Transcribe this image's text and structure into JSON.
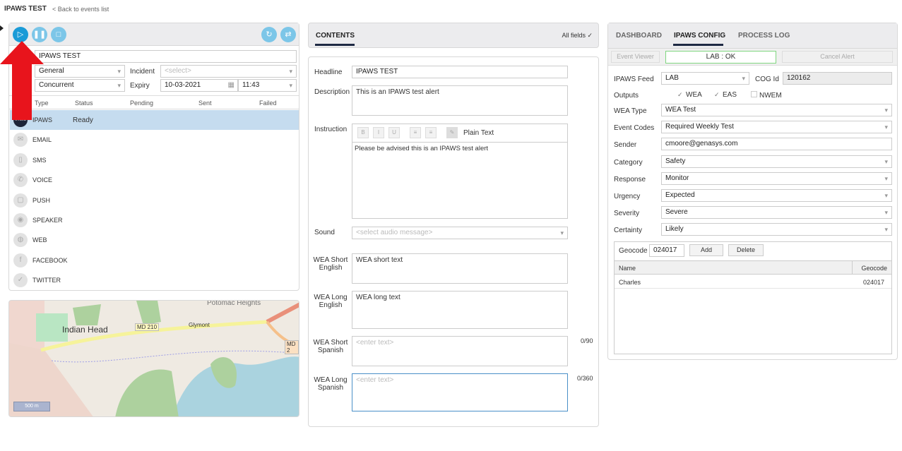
{
  "page": {
    "title": "IPAWS TEST",
    "back_link": "< Back to events list"
  },
  "left": {
    "event_label": "E",
    "event_value": "IPAWS TEST",
    "type_value": "General",
    "incident_label": "Incident",
    "incident_placeholder": "<select>",
    "mode_value": "Concurrent",
    "expiry_label": "Expiry",
    "expiry_date": "10-03-2021",
    "expiry_time": "11:43",
    "columns": [
      "Type",
      "Status",
      "Pending",
      "Sent",
      "Failed"
    ],
    "channels": [
      {
        "name": "IPAWS",
        "status": "Ready",
        "icon": "ipaws-logo-icon"
      },
      {
        "name": "EMAIL",
        "status": "",
        "icon": "email-icon"
      },
      {
        "name": "SMS",
        "status": "",
        "icon": "sms-icon"
      },
      {
        "name": "VOICE",
        "status": "",
        "icon": "phone-icon"
      },
      {
        "name": "PUSH",
        "status": "",
        "icon": "push-icon"
      },
      {
        "name": "SPEAKER",
        "status": "",
        "icon": "speaker-icon"
      },
      {
        "name": "WEB",
        "status": "",
        "icon": "globe-icon"
      },
      {
        "name": "FACEBOOK",
        "status": "",
        "icon": "facebook-icon"
      },
      {
        "name": "TWITTER",
        "status": "",
        "icon": "twitter-icon"
      }
    ],
    "ipaws_logo_text": "IPAWS"
  },
  "map": {
    "labels": [
      "Indian Head",
      "MD 210",
      "Glymont",
      "Potomac Heights",
      "MD 2"
    ],
    "scale": "500 m"
  },
  "contents": {
    "tab": "CONTENTS",
    "all_fields": "All fields ✓",
    "headline_label": "Headline",
    "headline": "IPAWS TEST",
    "description_label": "Description",
    "description": "This is an IPAWS test alert",
    "instruction_label": "Instruction",
    "toolbar": [
      "B",
      "I",
      "U",
      "≡",
      "≡",
      "✎"
    ],
    "plain_text": "Plain Text",
    "instruction": "Please be advised this is an IPAWS test alert",
    "sound_label": "Sound",
    "sound_placeholder": "<select audio message>",
    "wea_short_en_label": "WEA Short English",
    "wea_short_en": "WEA short text",
    "wea_long_en_label": "WEA Long English",
    "wea_long_en": "WEA long text",
    "wea_short_es_label": "WEA Short Spanish",
    "wea_short_es_placeholder": "<enter text>",
    "wea_short_es_count": "0/90",
    "wea_long_es_label": "WEA Long Spanish",
    "wea_long_es_placeholder": "<enter text>",
    "wea_long_es_count": "0/360"
  },
  "right": {
    "tabs": [
      "DASHBOARD",
      "IPAWS CONFIG",
      "PROCESS LOG"
    ],
    "active_tab": "IPAWS CONFIG",
    "event_viewer": "Event Viewer",
    "status": "LAB : OK",
    "cancel_alert": "Cancel Alert",
    "feed_label": "IPAWS Feed",
    "feed": "LAB",
    "cog_label": "COG Id",
    "cog": "120162",
    "outputs_label": "Outputs",
    "outputs": [
      {
        "label": "WEA",
        "checked": true
      },
      {
        "label": "EAS",
        "checked": true
      },
      {
        "label": "NWEM",
        "checked": false
      }
    ],
    "fields": [
      {
        "label": "WEA Type",
        "value": "WEA Test"
      },
      {
        "label": "Event Codes",
        "value": "Required Weekly Test"
      },
      {
        "label": "Sender",
        "value": "cmoore@genasys.com"
      },
      {
        "label": "Category",
        "value": "Safety"
      },
      {
        "label": "Response",
        "value": "Monitor"
      },
      {
        "label": "Urgency",
        "value": "Expected"
      },
      {
        "label": "Severity",
        "value": "Severe"
      },
      {
        "label": "Certainty",
        "value": "Likely"
      }
    ],
    "geocode_label": "Geocode",
    "geocode": "024017",
    "add": "Add",
    "delete": "Delete",
    "geo_columns": [
      "Name",
      "Geocode"
    ],
    "geo_rows": [
      {
        "name": "Charles",
        "code": "024017"
      }
    ]
  },
  "colors": {
    "accent": "#1a9bd7",
    "selected_row": "#c5dcef",
    "status_ok_border": "#7fd67f",
    "arrow": "#e8141c"
  }
}
